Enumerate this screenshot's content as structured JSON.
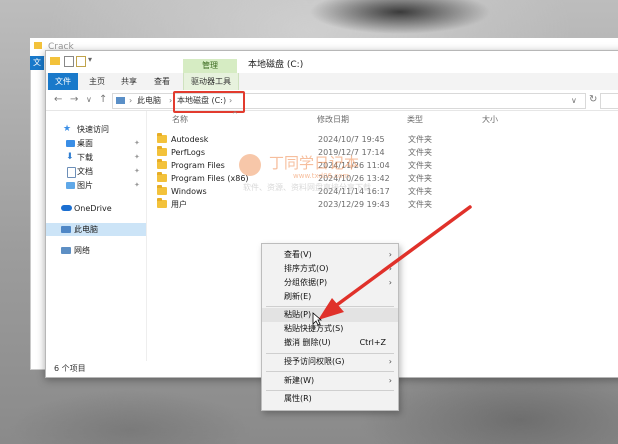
{
  "background_window": {
    "title": "Crack",
    "tab_file": "文"
  },
  "window": {
    "title": "本地磁盘 (C:)",
    "ribbon_context_group": "管理",
    "tabs": [
      {
        "label": "文件"
      },
      {
        "label": "主页"
      },
      {
        "label": "共享"
      },
      {
        "label": "查看"
      },
      {
        "label": "驱动器工具"
      }
    ]
  },
  "address_bar": {
    "crumbs": [
      "此电脑",
      "本地磁盘 (C:)"
    ],
    "nav": {
      "back": "←",
      "forward": "→",
      "dropdown": "∨",
      "up": "↑"
    },
    "history_dropdown": "∨",
    "refresh": "↻"
  },
  "sidebar": {
    "items": [
      {
        "label": "快速访问",
        "pinned": false
      },
      {
        "label": "桌面",
        "pinned": true
      },
      {
        "label": "下载",
        "pinned": true
      },
      {
        "label": "文档",
        "pinned": true
      },
      {
        "label": "图片",
        "pinned": true
      },
      {
        "label": "OneDrive",
        "pinned": false
      },
      {
        "label": "此电脑",
        "pinned": false,
        "selected": true
      },
      {
        "label": "网络",
        "pinned": false
      }
    ]
  },
  "columns": {
    "name": "名称",
    "date": "修改日期",
    "type": "类型",
    "size": "大小"
  },
  "files": [
    {
      "name": "Autodesk",
      "date": "2024/10/7 19:45",
      "type": "文件夹"
    },
    {
      "name": "PerfLogs",
      "date": "2019/12/7 17:14",
      "type": "文件夹"
    },
    {
      "name": "Program Files",
      "date": "2024/11/26 11:04",
      "type": "文件夹"
    },
    {
      "name": "Program Files (x86)",
      "date": "2024/10/26 13:42",
      "type": "文件夹"
    },
    {
      "name": "Windows",
      "date": "2024/11/14 16:17",
      "type": "文件夹"
    },
    {
      "name": "用户",
      "date": "2023/12/29 19:43",
      "type": "文件夹"
    }
  ],
  "status_bar": {
    "item_count": "6 个项目"
  },
  "watermark": {
    "title": "丁同学日记本",
    "url": "www.txd06.com",
    "tagline": "软件、资源、资料网盘直接分享下载"
  },
  "context_menu": {
    "items": [
      {
        "label": "查看(V)",
        "submenu": true
      },
      {
        "label": "排序方式(O)",
        "submenu": true
      },
      {
        "label": "分组依据(P)",
        "submenu": true
      },
      {
        "label": "刷新(E)"
      },
      {
        "label": "粘贴(P)",
        "highlighted": true
      },
      {
        "label": "粘贴快捷方式(S)"
      },
      {
        "label": "撤消 删除(U)",
        "shortcut": "Ctrl+Z"
      },
      {
        "label": "授予访问权限(G)",
        "submenu": true
      },
      {
        "label": "新建(W)",
        "submenu": true
      },
      {
        "label": "属性(R)"
      }
    ],
    "submenu_arrow": "›"
  },
  "colors": {
    "accent_blue": "#1979ca",
    "highlight_box": "#e23b2e",
    "arrow_red": "#e0312a",
    "folder_yellow": "#f3c23b"
  },
  "icons": {
    "folder": "folder-icon",
    "quick_access": "star-icon",
    "desktop": "desktop-icon",
    "downloads": "download-icon",
    "documents": "document-icon",
    "pictures": "picture-icon",
    "onedrive": "cloud-icon",
    "this_pc": "computer-icon",
    "network": "network-icon",
    "pin": "pin-icon"
  }
}
